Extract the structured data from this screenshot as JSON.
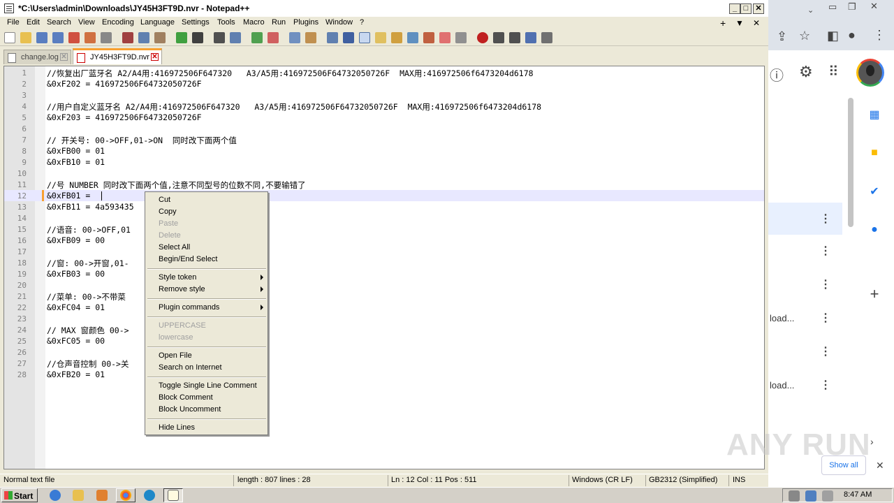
{
  "window": {
    "title": "*C:\\Users\\admin\\Downloads\\JY45H3FT9D.nvr - Notepad++",
    "minimize": "_",
    "maximize": "□",
    "close": "✕"
  },
  "menu": {
    "items": [
      "File",
      "Edit",
      "Search",
      "View",
      "Encoding",
      "Language",
      "Settings",
      "Tools",
      "Macro",
      "Run",
      "Plugins",
      "Window",
      "?"
    ],
    "right_controls": [
      "+",
      "▼",
      "✕"
    ]
  },
  "tabs": [
    {
      "label": "change.log",
      "active": false,
      "close": "✕"
    },
    {
      "label": "JY45H3FT9D.nvr",
      "active": true,
      "close": "✕"
    }
  ],
  "editor": {
    "current_line": 12,
    "lines": [
      {
        "n": "1",
        "text": "//恢复出厂蓝牙名 A2/A4用:416972506F647320   A3/A5用:416972506F64732050726F  MAX用:416972506f6473204d6178"
      },
      {
        "n": "2",
        "text": "&0xF202 = 416972506F64732050726F"
      },
      {
        "n": "3",
        "text": ""
      },
      {
        "n": "4",
        "text": "//用户自定义蓝牙名 A2/A4用:416972506F647320   A3/A5用:416972506F64732050726F  MAX用:416972506f6473204d6178"
      },
      {
        "n": "5",
        "text": "&0xF203 = 416972506F64732050726F"
      },
      {
        "n": "6",
        "text": ""
      },
      {
        "n": "7",
        "text": "// 开关号: 00->OFF,01->ON  同时改下面两个值"
      },
      {
        "n": "8",
        "text": "&0xFB00 = 01"
      },
      {
        "n": "9",
        "text": "&0xFB10 = 01"
      },
      {
        "n": "10",
        "text": ""
      },
      {
        "n": "11",
        "text": "//号 NUMBER 同时改下面两个值,注意不同型号的位数不同,不要输错了"
      },
      {
        "n": "12",
        "text": "&0xFB01 = "
      },
      {
        "n": "13",
        "text": "&0xFB11 = 4a593435"
      },
      {
        "n": "14",
        "text": ""
      },
      {
        "n": "15",
        "text": "//语音: 00->OFF,01"
      },
      {
        "n": "16",
        "text": "&0xFB09 = 00"
      },
      {
        "n": "17",
        "text": ""
      },
      {
        "n": "18",
        "text": "//窗: 00->开窗,01-"
      },
      {
        "n": "19",
        "text": "&0xFB03 = 00"
      },
      {
        "n": "20",
        "text": ""
      },
      {
        "n": "21",
        "text": "//菜单: 00->不带菜"
      },
      {
        "n": "22",
        "text": "&0xFC04 = 01"
      },
      {
        "n": "23",
        "text": ""
      },
      {
        "n": "24",
        "text": "// MAX 窗颜色 00->"
      },
      {
        "n": "25",
        "text": "&0xFC05 = 00"
      },
      {
        "n": "26",
        "text": ""
      },
      {
        "n": "27",
        "text": "//仓声音控制 00->关"
      },
      {
        "n": "28",
        "text": "&0xFB20 = 01"
      }
    ]
  },
  "context_menu": {
    "items": [
      {
        "label": "Cut",
        "disabled": false
      },
      {
        "label": "Copy",
        "disabled": false
      },
      {
        "label": "Paste",
        "disabled": true
      },
      {
        "label": "Delete",
        "disabled": true
      },
      {
        "label": "Select All",
        "disabled": false
      },
      {
        "label": "Begin/End Select",
        "disabled": false
      },
      {
        "label": "Style token",
        "disabled": false,
        "submenu": true
      },
      {
        "label": "Remove style",
        "disabled": false,
        "submenu": true
      },
      {
        "label": "Plugin commands",
        "disabled": false,
        "submenu": true
      },
      {
        "label": "UPPERCASE",
        "disabled": true
      },
      {
        "label": "lowercase",
        "disabled": true
      },
      {
        "label": "Open File",
        "disabled": false
      },
      {
        "label": "Search on Internet",
        "disabled": false
      },
      {
        "label": "Toggle Single Line Comment",
        "disabled": false
      },
      {
        "label": "Block Comment",
        "disabled": false
      },
      {
        "label": "Block Uncomment",
        "disabled": false
      },
      {
        "label": "Hide Lines",
        "disabled": false
      }
    ]
  },
  "statusbar": {
    "type": "Normal text file",
    "length": "length : 807    lines : 28",
    "position": "Ln : 12    Col : 11    Pos : 511",
    "eol": "Windows (CR LF)",
    "encoding": "GB2312 (Simplified)",
    "mode": "INS"
  },
  "browser": {
    "rows": [
      {
        "label": "",
        "dots": "⋮"
      },
      {
        "label": "",
        "dots": "⋮"
      },
      {
        "label": "",
        "dots": "⋮"
      },
      {
        "label": "load...",
        "dots": "⋮"
      },
      {
        "label": "",
        "dots": "⋮"
      },
      {
        "label": "load...",
        "dots": "⋮"
      }
    ],
    "show_all": "Show all",
    "close": "✕",
    "watermark": "ANY RUN"
  },
  "taskbar": {
    "start": "Start",
    "clock": "8:47 AM"
  }
}
